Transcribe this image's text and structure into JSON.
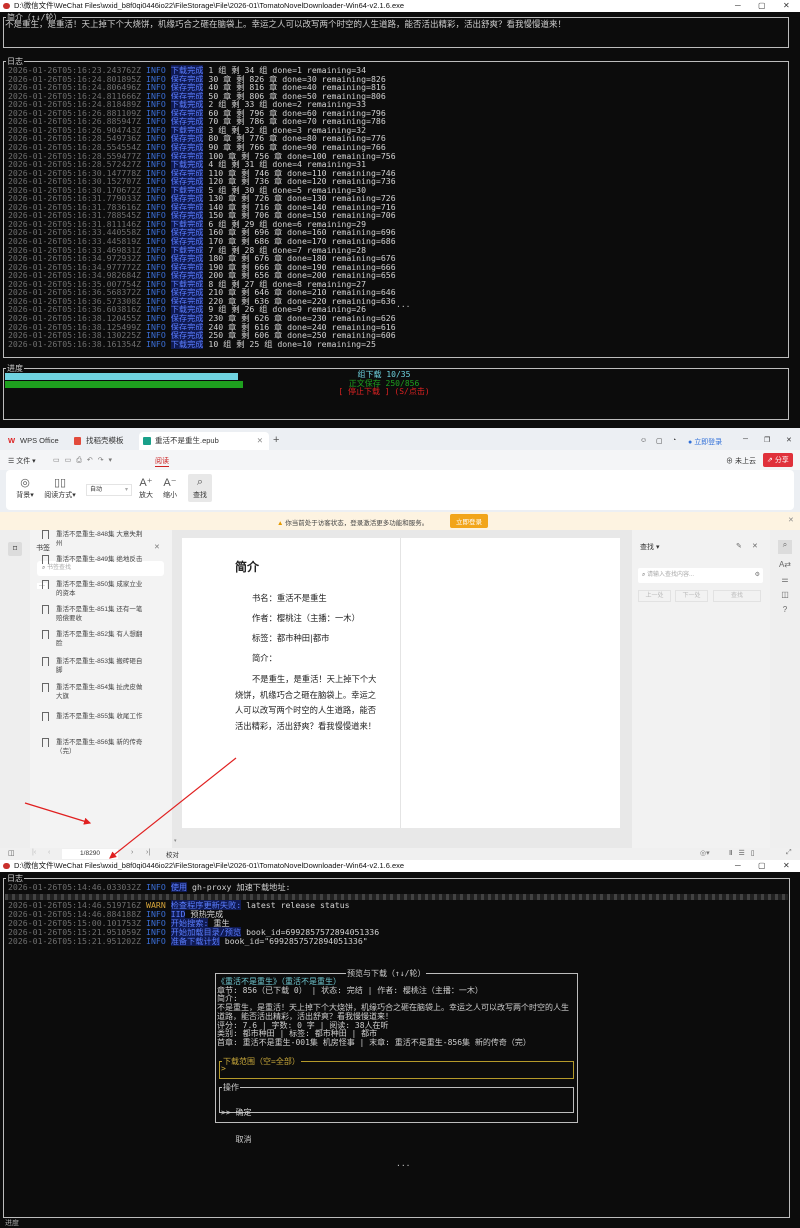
{
  "window1": {
    "title": "D:\\微信文件\\WeChat Files\\wxid_b8f0qi0446io22\\FileStorage\\File\\2026-01\\TomatoNovelDownloader-Win64-v2.1.6.exe",
    "intro_label": "简介（↑↓/轮）",
    "intro_text": "不是重生，是重活！天上掉下个大烧饼，机缘巧合之砸在脑袋上。幸运之人可以改写两个时空的人生道路，能否活出精彩，活出舒爽？看我慢慢道来！",
    "log_label": "日志",
    "logs": [
      {
        "ts": "2026-01-26T05:16:23.243762Z",
        "level": "INFO",
        "tag": "下载完成",
        "msg": "1 组 剩 34 组 done=1 remaining=34"
      },
      {
        "ts": "2026-01-26T05:16:24.801895Z",
        "level": "INFO",
        "tag": "保存完成",
        "msg": "30 章 剩 826 章 done=30 remaining=826"
      },
      {
        "ts": "2026-01-26T05:16:24.806496Z",
        "level": "INFO",
        "tag": "保存完成",
        "msg": "40 章 剩 816 章 done=40 remaining=816"
      },
      {
        "ts": "2026-01-26T05:16:24.811666Z",
        "level": "INFO",
        "tag": "保存完成",
        "msg": "50 章 剩 806 章 done=50 remaining=806"
      },
      {
        "ts": "2026-01-26T05:16:24.818489Z",
        "level": "INFO",
        "tag": "下载完成",
        "msg": "2 组 剩 33 组 done=2 remaining=33"
      },
      {
        "ts": "2026-01-26T05:16:26.881109Z",
        "level": "INFO",
        "tag": "保存完成",
        "msg": "60 章 剩 796 章 done=60 remaining=796"
      },
      {
        "ts": "2026-01-26T05:16:26.885947Z",
        "level": "INFO",
        "tag": "保存完成",
        "msg": "70 章 剩 786 章 done=70 remaining=786"
      },
      {
        "ts": "2026-01-26T05:16:26.904743Z",
        "level": "INFO",
        "tag": "下载完成",
        "msg": "3 组 剩 32 组 done=3 remaining=32"
      },
      {
        "ts": "2026-01-26T05:16:28.549736Z",
        "level": "INFO",
        "tag": "保存完成",
        "msg": "80 章 剩 776 章 done=80 remaining=776"
      },
      {
        "ts": "2026-01-26T05:16:28.554554Z",
        "level": "INFO",
        "tag": "保存完成",
        "msg": "90 章 剩 766 章 done=90 remaining=766"
      },
      {
        "ts": "2026-01-26T05:16:28.559477Z",
        "level": "INFO",
        "tag": "保存完成",
        "msg": "100 章 剩 756 章 done=100 remaining=756"
      },
      {
        "ts": "2026-01-26T05:16:28.572427Z",
        "level": "INFO",
        "tag": "下载完成",
        "msg": "4 组 剩 31 组 done=4 remaining=31"
      },
      {
        "ts": "2026-01-26T05:16:30.147778Z",
        "level": "INFO",
        "tag": "保存完成",
        "msg": "110 章 剩 746 章 done=110 remaining=746"
      },
      {
        "ts": "2026-01-26T05:16:30.152707Z",
        "level": "INFO",
        "tag": "保存完成",
        "msg": "120 章 剩 736 章 done=120 remaining=736"
      },
      {
        "ts": "2026-01-26T05:16:30.170672Z",
        "level": "INFO",
        "tag": "下载完成",
        "msg": "5 组 剩 30 组 done=5 remaining=30"
      },
      {
        "ts": "2026-01-26T05:16:31.779033Z",
        "level": "INFO",
        "tag": "保存完成",
        "msg": "130 章 剩 726 章 done=130 remaining=726"
      },
      {
        "ts": "2026-01-26T05:16:31.783616Z",
        "level": "INFO",
        "tag": "保存完成",
        "msg": "140 章 剩 716 章 done=140 remaining=716"
      },
      {
        "ts": "2026-01-26T05:16:31.788545Z",
        "level": "INFO",
        "tag": "保存完成",
        "msg": "150 章 剩 706 章 done=150 remaining=706"
      },
      {
        "ts": "2026-01-26T05:16:31.811146Z",
        "level": "INFO",
        "tag": "下载完成",
        "msg": "6 组 剩 29 组 done=6 remaining=29"
      },
      {
        "ts": "2026-01-26T05:16:33.440558Z",
        "level": "INFO",
        "tag": "保存完成",
        "msg": "160 章 剩 696 章 done=160 remaining=696"
      },
      {
        "ts": "2026-01-26T05:16:33.445819Z",
        "level": "INFO",
        "tag": "保存完成",
        "msg": "170 章 剩 686 章 done=170 remaining=686"
      },
      {
        "ts": "2026-01-26T05:16:33.469831Z",
        "level": "INFO",
        "tag": "下载完成",
        "msg": "7 组 剩 28 组 done=7 remaining=28"
      },
      {
        "ts": "2026-01-26T05:16:34.972932Z",
        "level": "INFO",
        "tag": "保存完成",
        "msg": "180 章 剩 676 章 done=180 remaining=676"
      },
      {
        "ts": "2026-01-26T05:16:34.977772Z",
        "level": "INFO",
        "tag": "保存完成",
        "msg": "190 章 剩 666 章 done=190 remaining=666"
      },
      {
        "ts": "2026-01-26T05:16:34.982684Z",
        "level": "INFO",
        "tag": "保存完成",
        "msg": "200 章 剩 656 章 done=200 remaining=656"
      },
      {
        "ts": "2026-01-26T05:16:35.007754Z",
        "level": "INFO",
        "tag": "下载完成",
        "msg": "8 组 剩 27 组 done=8 remaining=27"
      },
      {
        "ts": "2026-01-26T05:16:36.568372Z",
        "level": "INFO",
        "tag": "保存完成",
        "msg": "210 章 剩 646 章 done=210 remaining=646"
      },
      {
        "ts": "2026-01-26T05:16:36.573308Z",
        "level": "INFO",
        "tag": "保存完成",
        "msg": "220 章 剩 636 章 done=220 remaining=636"
      },
      {
        "ts": "2026-01-26T05:16:36.603816Z",
        "level": "INFO",
        "tag": "下载完成",
        "msg": "9 组 剩 26 组 done=9 remaining=26"
      },
      {
        "ts": "2026-01-26T05:16:38.120455Z",
        "level": "INFO",
        "tag": "保存完成",
        "msg": "230 章 剩 626 章 done=230 remaining=626"
      },
      {
        "ts": "2026-01-26T05:16:38.125499Z",
        "level": "INFO",
        "tag": "保存完成",
        "msg": "240 章 剩 616 章 done=240 remaining=616"
      },
      {
        "ts": "2026-01-26T05:16:38.130225Z",
        "level": "INFO",
        "tag": "保存完成",
        "msg": "250 章 剩 606 章 done=250 remaining=606"
      },
      {
        "ts": "2026-01-26T05:16:38.161354Z",
        "level": "INFO",
        "tag": "下载完成",
        "msg": "10 组 剩 25 组 done=10 remaining=25"
      }
    ],
    "ellipsis": "...",
    "progress_label": "进度",
    "group_progress": {
      "text": "组下载 10/35",
      "fraction": 0.2857,
      "color": "#6fd3e0"
    },
    "save_progress": {
      "text": "正文保存 250/856",
      "fraction": 0.292,
      "color": "#1ea01e"
    },
    "stop_button": "[ 停止下载 ] (S/点击)"
  },
  "wps": {
    "tabs": [
      "WPS Office",
      "找稻壳模板",
      "重活不是重生.epub"
    ],
    "login": "立即登录",
    "menu_file": "文件",
    "menu_read": "阅读",
    "cloud": "未上云",
    "share": "分享",
    "ribbon": {
      "background": "背景",
      "read_mode": "阅读方式",
      "zoom_select": "自动",
      "zoom_in": "放大",
      "zoom_out": "缩小",
      "find": "查找"
    },
    "banner_text": "你当前处于访客状态，登录激活更多功能和服务。",
    "banner_button": "立即登录",
    "bookmarks": {
      "title": "书签",
      "search_placeholder": "书签查找",
      "more": "···",
      "items": [
        "重活不是重生-848集 大意失荆州",
        "重活不是重生-849集 绝地反击",
        "重活不是重生-850集 成家立业的资本",
        "重活不是重生-851集 还有一笔赔偿要收",
        "重活不是重生-852集 有人想翻脸",
        "重活不是重生-853集 搬砖砸自脚",
        "重活不是重生-854集 扯虎皮做大旗",
        "重活不是重生-855集 收尾工作",
        "重活不是重生-856集 新的传奇（完）"
      ]
    },
    "page": {
      "heading": "简介",
      "lines": [
        "书名：重活不是重生",
        "作者：樱桃注（主播：一木）",
        "标签：都市种田|都市",
        "简介："
      ],
      "body": "不是重生，是重活！天上掉下个大烧饼，机缘巧合之砸在脑袋上。幸运之人可以改写两个时空的人生道路，能否活出精彩，活出舒爽？看我慢慢道来！"
    },
    "find_panel": {
      "title": "查找",
      "placeholder": "请输入查找内容...",
      "prev": "上一处",
      "next": "下一处",
      "find": "查找"
    },
    "status": {
      "page": "1/8290",
      "proofread": "校对"
    }
  },
  "window2": {
    "title": "D:\\微信文件\\WeChat Files\\wxid_b8f0qi0446io22\\FileStorage\\File\\2026-01\\TomatoNovelDownloader-Win64-v2.1.6.exe",
    "log_label": "日志",
    "logs": [
      {
        "ts": "2026-01-26T05:14:46.033032Z",
        "level": "INFO",
        "tag": "使用",
        "msg": "gh-proxy 加速下载地址:"
      },
      {
        "ts": "2026-01-26T05:14:46.519716Z",
        "level": "WARN",
        "tag": "检查程序更新失败:",
        "msg": "latest release status"
      },
      {
        "ts": "2026-01-26T05:14:46.884188Z",
        "level": "INFO",
        "tag": "IID",
        "msg": "预热完成"
      },
      {
        "ts": "2026-01-26T05:15:00.101753Z",
        "level": "INFO",
        "tag": "开始搜索:",
        "msg": "重生"
      },
      {
        "ts": "2026-01-26T05:15:21.951059Z",
        "level": "INFO",
        "tag": "开始加载目录/预览",
        "msg": "book_id=6992857572894051336"
      },
      {
        "ts": "2026-01-26T05:15:21.951202Z",
        "level": "INFO",
        "tag": "准备下载计划",
        "msg": "book_id=\"6992857572894051336\""
      }
    ],
    "dialog": {
      "title": "预览与下载（↑↓/轮）",
      "book": "《重活不是重生》（重活不是重生）",
      "meta": "章节: 856（已下载 0） | 状态: 完结 | 作者: 樱桃注（主播：一木）",
      "intro_label": "简介:",
      "intro": "不是重生，是重活！天上掉下个大烧饼，机缘巧合之砸在脑袋上。幸运之人可以改写两个时空的人生道路，能否活出精彩，活出舒爽？看我慢慢道来！",
      "stats": "评分: 7.6 | 字数: 0 字 | 阅读: 38人在听",
      "category": "类别: 都市种田 | 标签: 都市种田 | 都市",
      "chapters": "首章: 重活不是重生-001集 机房怪事 | 末章: 重活不是重生-856集 新的传奇（完）",
      "range_label": "下载范围（空=全部）",
      "range_prompt": ">",
      "ops_label": "操作",
      "confirm": ">> 确定",
      "cancel": "   取消"
    },
    "ellipsis": "...",
    "progress_label": "进度"
  }
}
